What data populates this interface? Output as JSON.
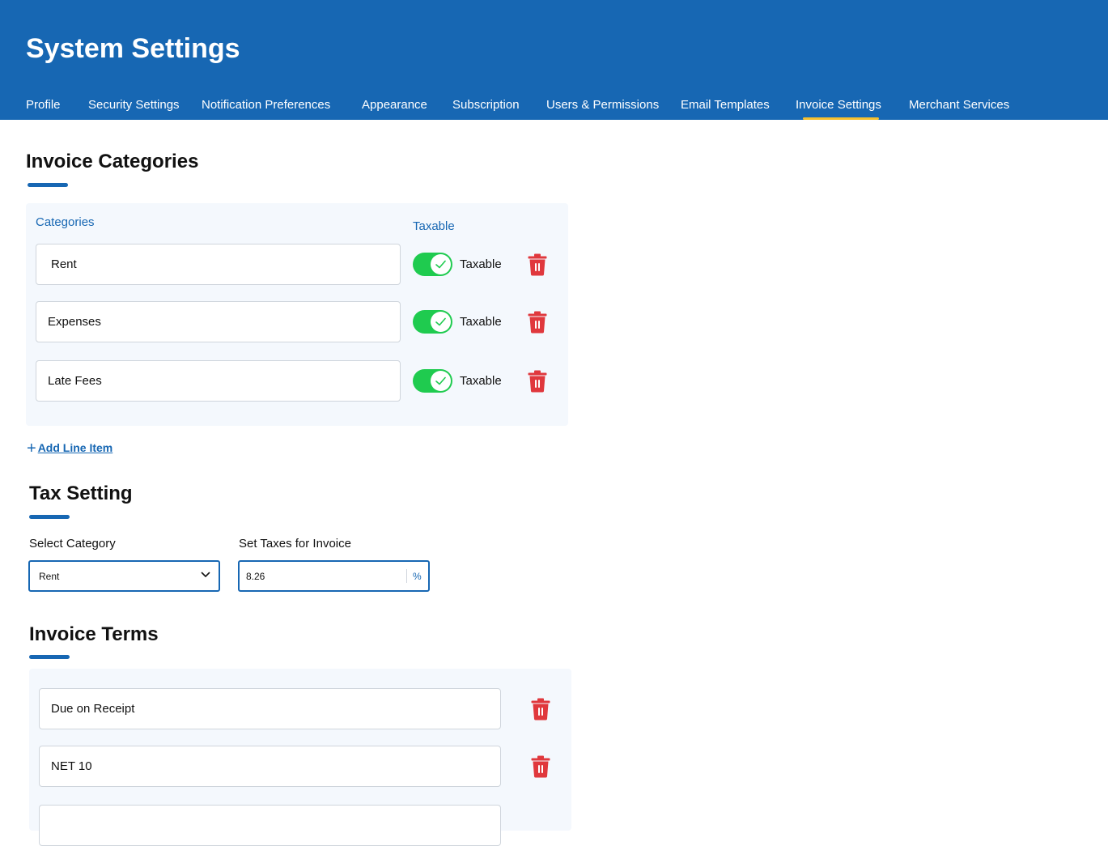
{
  "header": {
    "title": "System Settings",
    "tabs": [
      {
        "label": "Profile"
      },
      {
        "label": "Security Settings"
      },
      {
        "label": "Notification Preferences"
      },
      {
        "label": "Appearance"
      },
      {
        "label": "Subscription"
      },
      {
        "label": "Users & Permissions"
      },
      {
        "label": "Email Templates"
      },
      {
        "label": "Invoice Settings",
        "active": true
      },
      {
        "label": "Merchant Services"
      }
    ],
    "accent_color": "#1767b3",
    "active_tab_underline_color": "#f5c02f"
  },
  "invoice_categories": {
    "title": "Invoice Categories",
    "column_categories": "Categories",
    "column_taxable": "Taxable",
    "rows": [
      {
        "name": "Rent",
        "taxable": true,
        "toggle_label": "Taxable",
        "delete_icon": "trash-icon"
      },
      {
        "name": "Expenses",
        "taxable": true,
        "toggle_label": "Taxable",
        "delete_icon": "trash-icon"
      },
      {
        "name": "Late Fees",
        "taxable": true,
        "toggle_label": "Taxable",
        "delete_icon": "trash-icon"
      }
    ],
    "add_line_label": "Add Line Item",
    "toggle_on_color": "#1fcb4f",
    "delete_color": "#e0383d"
  },
  "tax_setting": {
    "title": "Tax Setting",
    "select_label": "Select Category",
    "selected_category": "Rent",
    "tax_label": "Set Taxes for Invoice",
    "tax_value": "8.26",
    "tax_suffix": "%"
  },
  "invoice_terms": {
    "title": "Invoice Terms",
    "rows": [
      {
        "name": "Due on Receipt"
      },
      {
        "name": "NET 10"
      },
      {
        "name": ""
      }
    ]
  }
}
